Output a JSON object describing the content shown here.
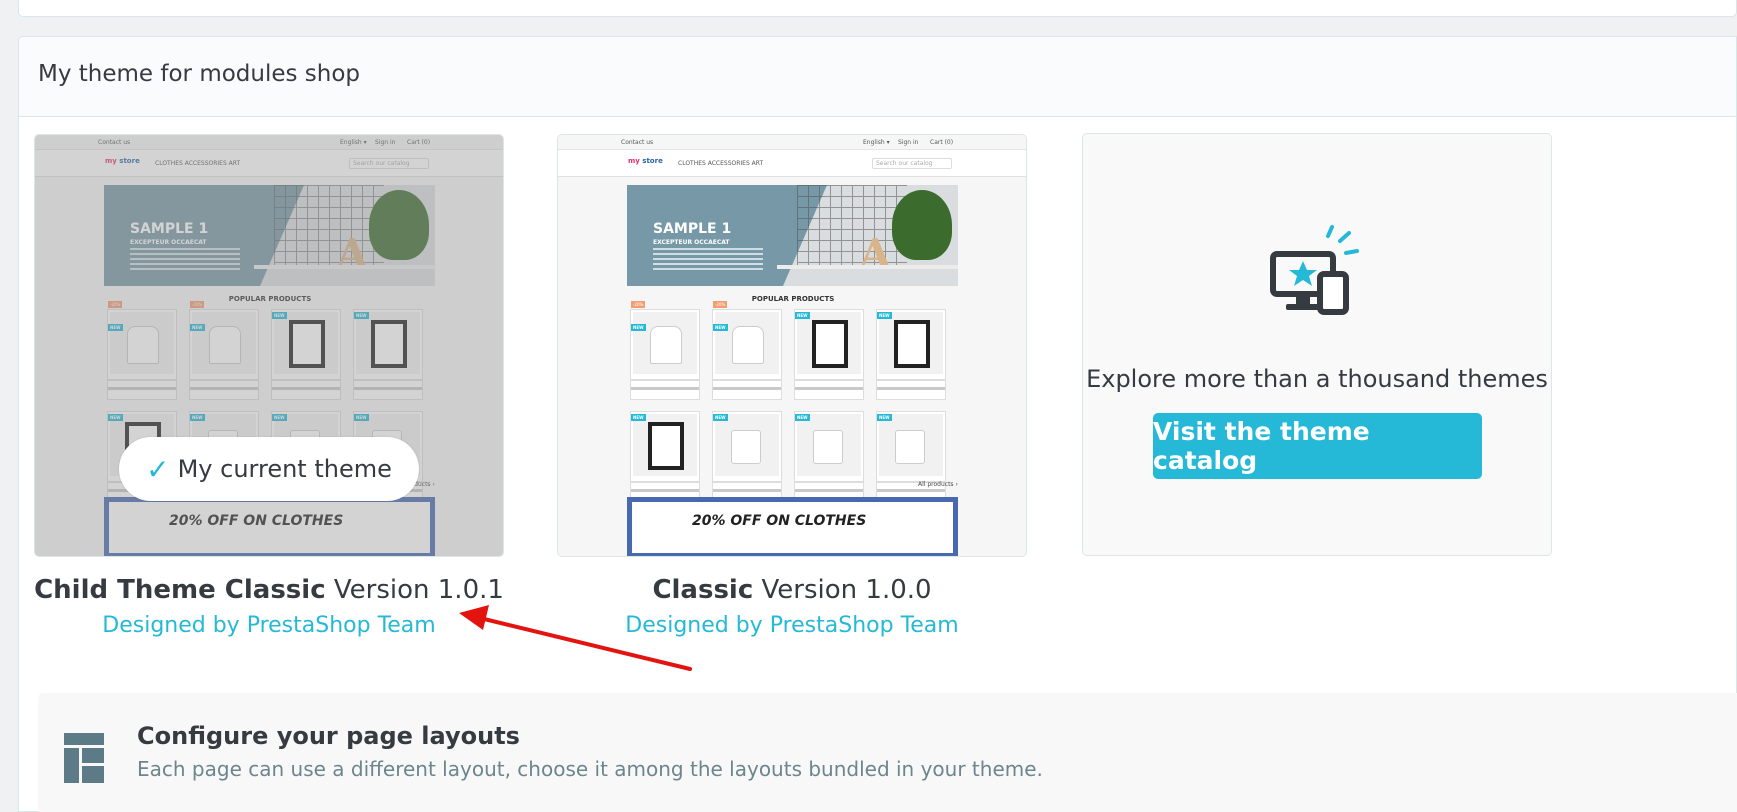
{
  "panel": {
    "title": "My theme for modules shop"
  },
  "themes": [
    {
      "name": "Child Theme Classic",
      "version": "Version 1.0.1",
      "author": "Designed by PrestaShop Team",
      "current": true,
      "current_label": "My current theme"
    },
    {
      "name": "Classic",
      "version": "Version 1.0.0",
      "author": "Designed by PrestaShop Team",
      "current": false
    }
  ],
  "preview": {
    "contact": "Contact us",
    "language": "English ▾",
    "signin": "Sign in",
    "cart": "Cart (0)",
    "logo_a": "my",
    "logo_b": " store",
    "menu": "CLOTHES   ACCESSORIES   ART",
    "search_placeholder": "Search our catalog",
    "slide_title": "SAMPLE 1",
    "slide_sub": "EXCEPTEUR OCCAECAT",
    "popular": "POPULAR PRODUCTS",
    "all_products": "All products ›",
    "promo": "20% OFF ON CLOTHES",
    "badge_new": "NEW",
    "badge_discount": "-20%"
  },
  "catalog": {
    "text": "Explore more than a thousand themes",
    "button": "Visit the theme catalog",
    "icon": "monitor-star-icon"
  },
  "layouts": {
    "title": "Configure your page layouts",
    "description": "Each page can use a different layout, choose it among the layouts bundled in your theme.",
    "icon": "layout-grid-icon"
  },
  "annotation": {
    "color": "#e3130f"
  },
  "colors": {
    "accent": "#25b9d7",
    "text": "#363a41"
  }
}
